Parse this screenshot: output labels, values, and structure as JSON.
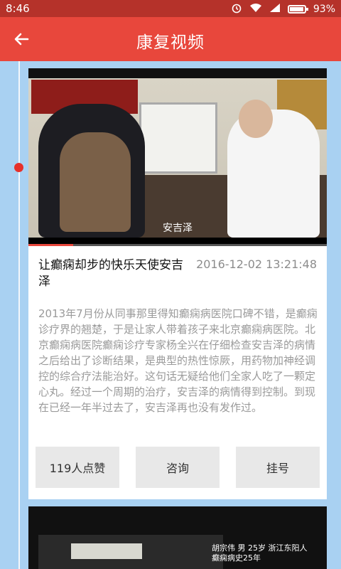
{
  "status": {
    "time": "8:46",
    "battery": "93%"
  },
  "appbar": {
    "title": "康复视频"
  },
  "card": {
    "video_caption": "安吉泽",
    "title": "让癫痫却步的快乐天使安吉泽",
    "date": "2016-12-02 13:21:48",
    "description": "2013年7月份从同事那里得知癫痫病医院口碑不错，是癫痫诊疗界的翘楚，于是让家人带着孩子来北京癫痫病医院。北京癫痫病医院癫痫诊疗专家杨全兴在仔细检查安吉泽的病情之后给出了诊断结果，是典型的热性惊厥，用药物加神经调控的综合疗法能治好。这句话无疑给他们全家人吃了一颗定心丸。经过一个周期的治疗，安吉泽的病情得到控制。到现在已经一年半过去了，安吉泽再也没有发作过。",
    "progress_percent": 15,
    "actions": {
      "likes": "119人点赞",
      "consult": "咨询",
      "register": "挂号"
    }
  },
  "card2": {
    "caption_line1": "胡宗伟  男  25岁  浙江东阳人",
    "caption_line2": "癫痫病史25年"
  }
}
